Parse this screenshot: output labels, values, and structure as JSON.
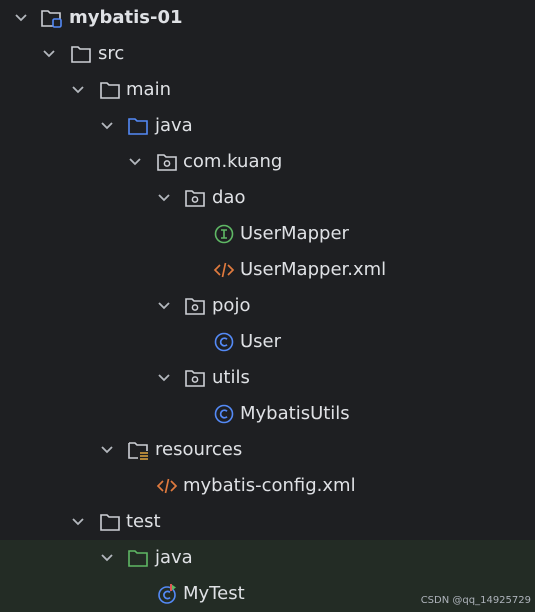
{
  "tree": {
    "project": "mybatis-01",
    "src": "src",
    "main": "main",
    "main_java": "java",
    "package": "com.kuang",
    "dao": "dao",
    "user_mapper": "UserMapper",
    "user_mapper_xml": "UserMapper.xml",
    "pojo": "pojo",
    "user": "User",
    "utils": "utils",
    "mybatis_utils": "MybatisUtils",
    "resources": "resources",
    "mybatis_config": "mybatis-config.xml",
    "test": "test",
    "test_java": "java",
    "my_test": "MyTest"
  },
  "watermark": "CSDN @qq_14925729",
  "colors": {
    "background": "#1e1f22",
    "test_area": "#232c25",
    "source_folder": "#548af7",
    "test_folder": "#5fb865",
    "interface": "#5fb865",
    "class": "#548af7",
    "xml": "#e07a3e"
  }
}
